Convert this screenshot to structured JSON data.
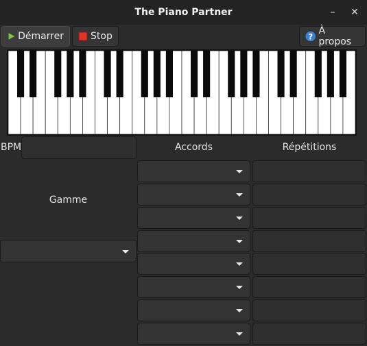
{
  "window": {
    "title": "The Piano Partner",
    "minimize_glyph": "–",
    "close_glyph": "✕"
  },
  "toolbar": {
    "start_label": "Démarrer",
    "start_icon": "play-icon",
    "stop_label": "Stop",
    "stop_icon": "stop-icon",
    "about_label": "À propos",
    "about_icon": "help-icon"
  },
  "form": {
    "bpm_label": "BPM",
    "bpm_value": "",
    "chords_header": "Accords",
    "repetitions_header": "Répétitions",
    "scale_label": "Gamme",
    "scale_value": "",
    "chord_rows": [
      {
        "chord": "",
        "repetitions": ""
      },
      {
        "chord": "",
        "repetitions": ""
      },
      {
        "chord": "",
        "repetitions": ""
      },
      {
        "chord": "",
        "repetitions": ""
      },
      {
        "chord": "",
        "repetitions": ""
      },
      {
        "chord": "",
        "repetitions": ""
      },
      {
        "chord": "",
        "repetitions": ""
      },
      {
        "chord": "",
        "repetitions": ""
      }
    ]
  },
  "piano": {
    "white_keys": 28,
    "colors": {
      "white": "#ffffff",
      "black": "#0a0a0a",
      "outline": "#111111"
    }
  },
  "colors": {
    "background": "#2b2b2b",
    "titlebar": "#232323",
    "play_green": "#7ec83b",
    "stop_red": "#e0342a",
    "help_blue": "#3a7fd0"
  }
}
